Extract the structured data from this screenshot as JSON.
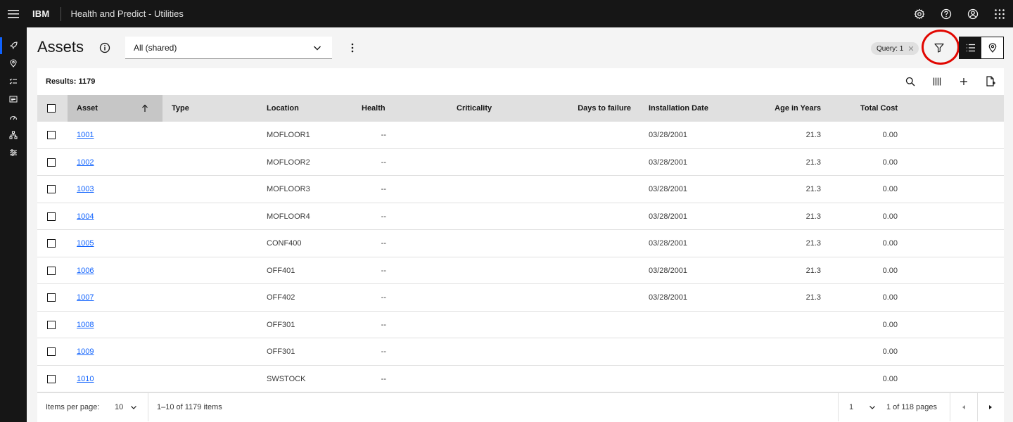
{
  "header": {
    "brand": "IBM",
    "app_title": "Health and Predict - Utilities"
  },
  "page": {
    "title": "Assets",
    "view_dropdown": {
      "selected": "All (shared)"
    },
    "query_tag": "Query: 1"
  },
  "results_label": "Results: 1179",
  "table": {
    "columns": [
      "Asset",
      "Type",
      "Location",
      "Health",
      "Criticality",
      "Days to failure",
      "Installation Date",
      "Age in Years",
      "Total Cost"
    ],
    "rows": [
      {
        "asset": "1001",
        "type": "",
        "location": "MOFLOOR1",
        "health": "--",
        "criticality": "",
        "days": "",
        "install": "03/28/2001",
        "age": "21.3",
        "cost": "0.00"
      },
      {
        "asset": "1002",
        "type": "",
        "location": "MOFLOOR2",
        "health": "--",
        "criticality": "",
        "days": "",
        "install": "03/28/2001",
        "age": "21.3",
        "cost": "0.00"
      },
      {
        "asset": "1003",
        "type": "",
        "location": "MOFLOOR3",
        "health": "--",
        "criticality": "",
        "days": "",
        "install": "03/28/2001",
        "age": "21.3",
        "cost": "0.00"
      },
      {
        "asset": "1004",
        "type": "",
        "location": "MOFLOOR4",
        "health": "--",
        "criticality": "",
        "days": "",
        "install": "03/28/2001",
        "age": "21.3",
        "cost": "0.00"
      },
      {
        "asset": "1005",
        "type": "",
        "location": "CONF400",
        "health": "--",
        "criticality": "",
        "days": "",
        "install": "03/28/2001",
        "age": "21.3",
        "cost": "0.00"
      },
      {
        "asset": "1006",
        "type": "",
        "location": "OFF401",
        "health": "--",
        "criticality": "",
        "days": "",
        "install": "03/28/2001",
        "age": "21.3",
        "cost": "0.00"
      },
      {
        "asset": "1007",
        "type": "",
        "location": "OFF402",
        "health": "--",
        "criticality": "",
        "days": "",
        "install": "03/28/2001",
        "age": "21.3",
        "cost": "0.00"
      },
      {
        "asset": "1008",
        "type": "",
        "location": "OFF301",
        "health": "--",
        "criticality": "",
        "days": "",
        "install": "",
        "age": "",
        "cost": "0.00"
      },
      {
        "asset": "1009",
        "type": "",
        "location": "OFF301",
        "health": "--",
        "criticality": "",
        "days": "",
        "install": "",
        "age": "",
        "cost": "0.00"
      },
      {
        "asset": "1010",
        "type": "",
        "location": "SWSTOCK",
        "health": "--",
        "criticality": "",
        "days": "",
        "install": "",
        "age": "",
        "cost": "0.00"
      }
    ]
  },
  "pagination": {
    "items_per_page_label": "Items per page:",
    "items_per_page": "10",
    "range_text": "1–10 of 1179 items",
    "current_page": "1",
    "pages_text": "1 of 118 pages"
  },
  "icons": {
    "top": [
      "settings-icon",
      "help-icon",
      "user-avatar-icon",
      "app-switcher-icon"
    ],
    "rail": [
      "rocket-icon",
      "location-icon",
      "checklist-icon",
      "dashboard-icon",
      "meter-icon",
      "hierarchy-icon",
      "sliders-icon"
    ]
  },
  "colors": {
    "link": "#0f62fe",
    "header_bg": "#161616",
    "highlight": "#e10600"
  }
}
